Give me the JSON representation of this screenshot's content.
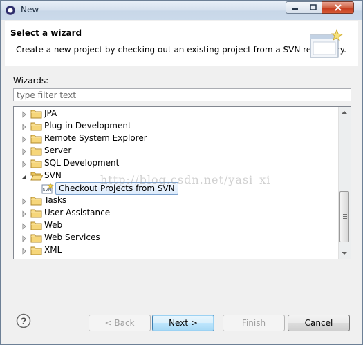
{
  "window": {
    "title": "New"
  },
  "header": {
    "title": "Select a wizard",
    "description": "Create a new project by checking out an existing project from a SVN repository."
  },
  "wizards_label": "Wizards:",
  "filter": {
    "placeholder": "type filter text",
    "value": ""
  },
  "tree": {
    "items": [
      {
        "label": "JPA",
        "expanded": false,
        "icon": "folder-icon"
      },
      {
        "label": "Plug-in Development",
        "expanded": false,
        "icon": "folder-icon"
      },
      {
        "label": "Remote System Explorer",
        "expanded": false,
        "icon": "folder-icon"
      },
      {
        "label": "Server",
        "expanded": false,
        "icon": "folder-icon"
      },
      {
        "label": "SQL Development",
        "expanded": false,
        "icon": "folder-icon"
      },
      {
        "label": "SVN",
        "expanded": true,
        "icon": "folder-open-icon"
      },
      {
        "label": "Checkout Projects from SVN",
        "child": true,
        "selected": true,
        "icon": "svn-checkout-icon"
      },
      {
        "label": "Tasks",
        "expanded": false,
        "icon": "folder-icon"
      },
      {
        "label": "User Assistance",
        "expanded": false,
        "icon": "folder-icon"
      },
      {
        "label": "Web",
        "expanded": false,
        "icon": "folder-icon"
      },
      {
        "label": "Web Services",
        "expanded": false,
        "icon": "folder-icon"
      },
      {
        "label": "XML",
        "expanded": false,
        "icon": "folder-icon"
      }
    ]
  },
  "watermark": "http://blog.csdn.net/yasi_xi",
  "buttons": {
    "back": "< Back",
    "next": "Next >",
    "finish": "Finish",
    "cancel": "Cancel"
  },
  "colors": {
    "selection_border": "#7da2ce",
    "folder": "#e8c15a",
    "close_button": "#c4381c"
  }
}
